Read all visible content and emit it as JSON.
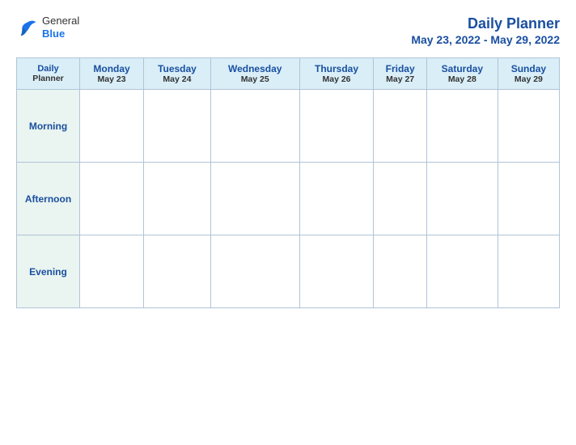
{
  "header": {
    "logo": {
      "general_text": "General",
      "blue_text": "Blue"
    },
    "title": "Daily Planner",
    "date_range": "May 23, 2022 - May 29, 2022"
  },
  "table": {
    "first_col_header": {
      "line1": "Daily",
      "line2": "Planner"
    },
    "columns": [
      {
        "day": "Monday",
        "date": "May 23"
      },
      {
        "day": "Tuesday",
        "date": "May 24"
      },
      {
        "day": "Wednesday",
        "date": "May 25"
      },
      {
        "day": "Thursday",
        "date": "May 26"
      },
      {
        "day": "Friday",
        "date": "May 27"
      },
      {
        "day": "Saturday",
        "date": "May 28"
      },
      {
        "day": "Sunday",
        "date": "May 29"
      }
    ],
    "rows": [
      {
        "label": "Morning"
      },
      {
        "label": "Afternoon"
      },
      {
        "label": "Evening"
      }
    ]
  }
}
